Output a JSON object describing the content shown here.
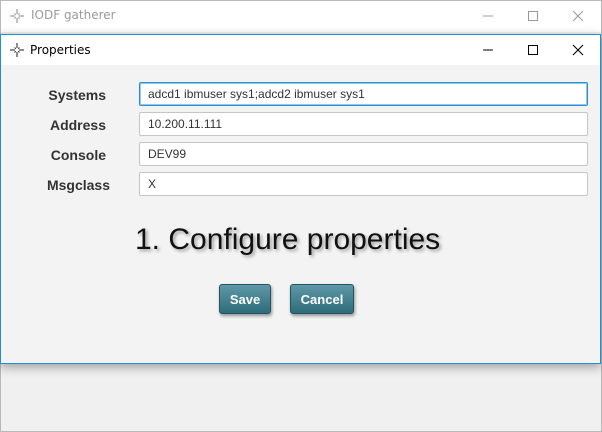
{
  "main_window": {
    "title": "IODF gatherer",
    "icon": "app-cross-icon"
  },
  "dialog": {
    "title": "Properties",
    "icon": "app-cross-icon",
    "accent_color": "#1f8fd6"
  },
  "form": {
    "systems": {
      "label": "Systems",
      "value": "adcd1 ibmuser sys1;adcd2 ibmuser sys1"
    },
    "address": {
      "label": "Address",
      "value": "10.200.11.111"
    },
    "console": {
      "label": "Console",
      "value": "DEV99"
    },
    "msgclass": {
      "label": "Msgclass",
      "value": "X"
    }
  },
  "annotation": "1. Configure properties",
  "buttons": {
    "save": "Save",
    "cancel": "Cancel",
    "color": "#3b7886"
  }
}
